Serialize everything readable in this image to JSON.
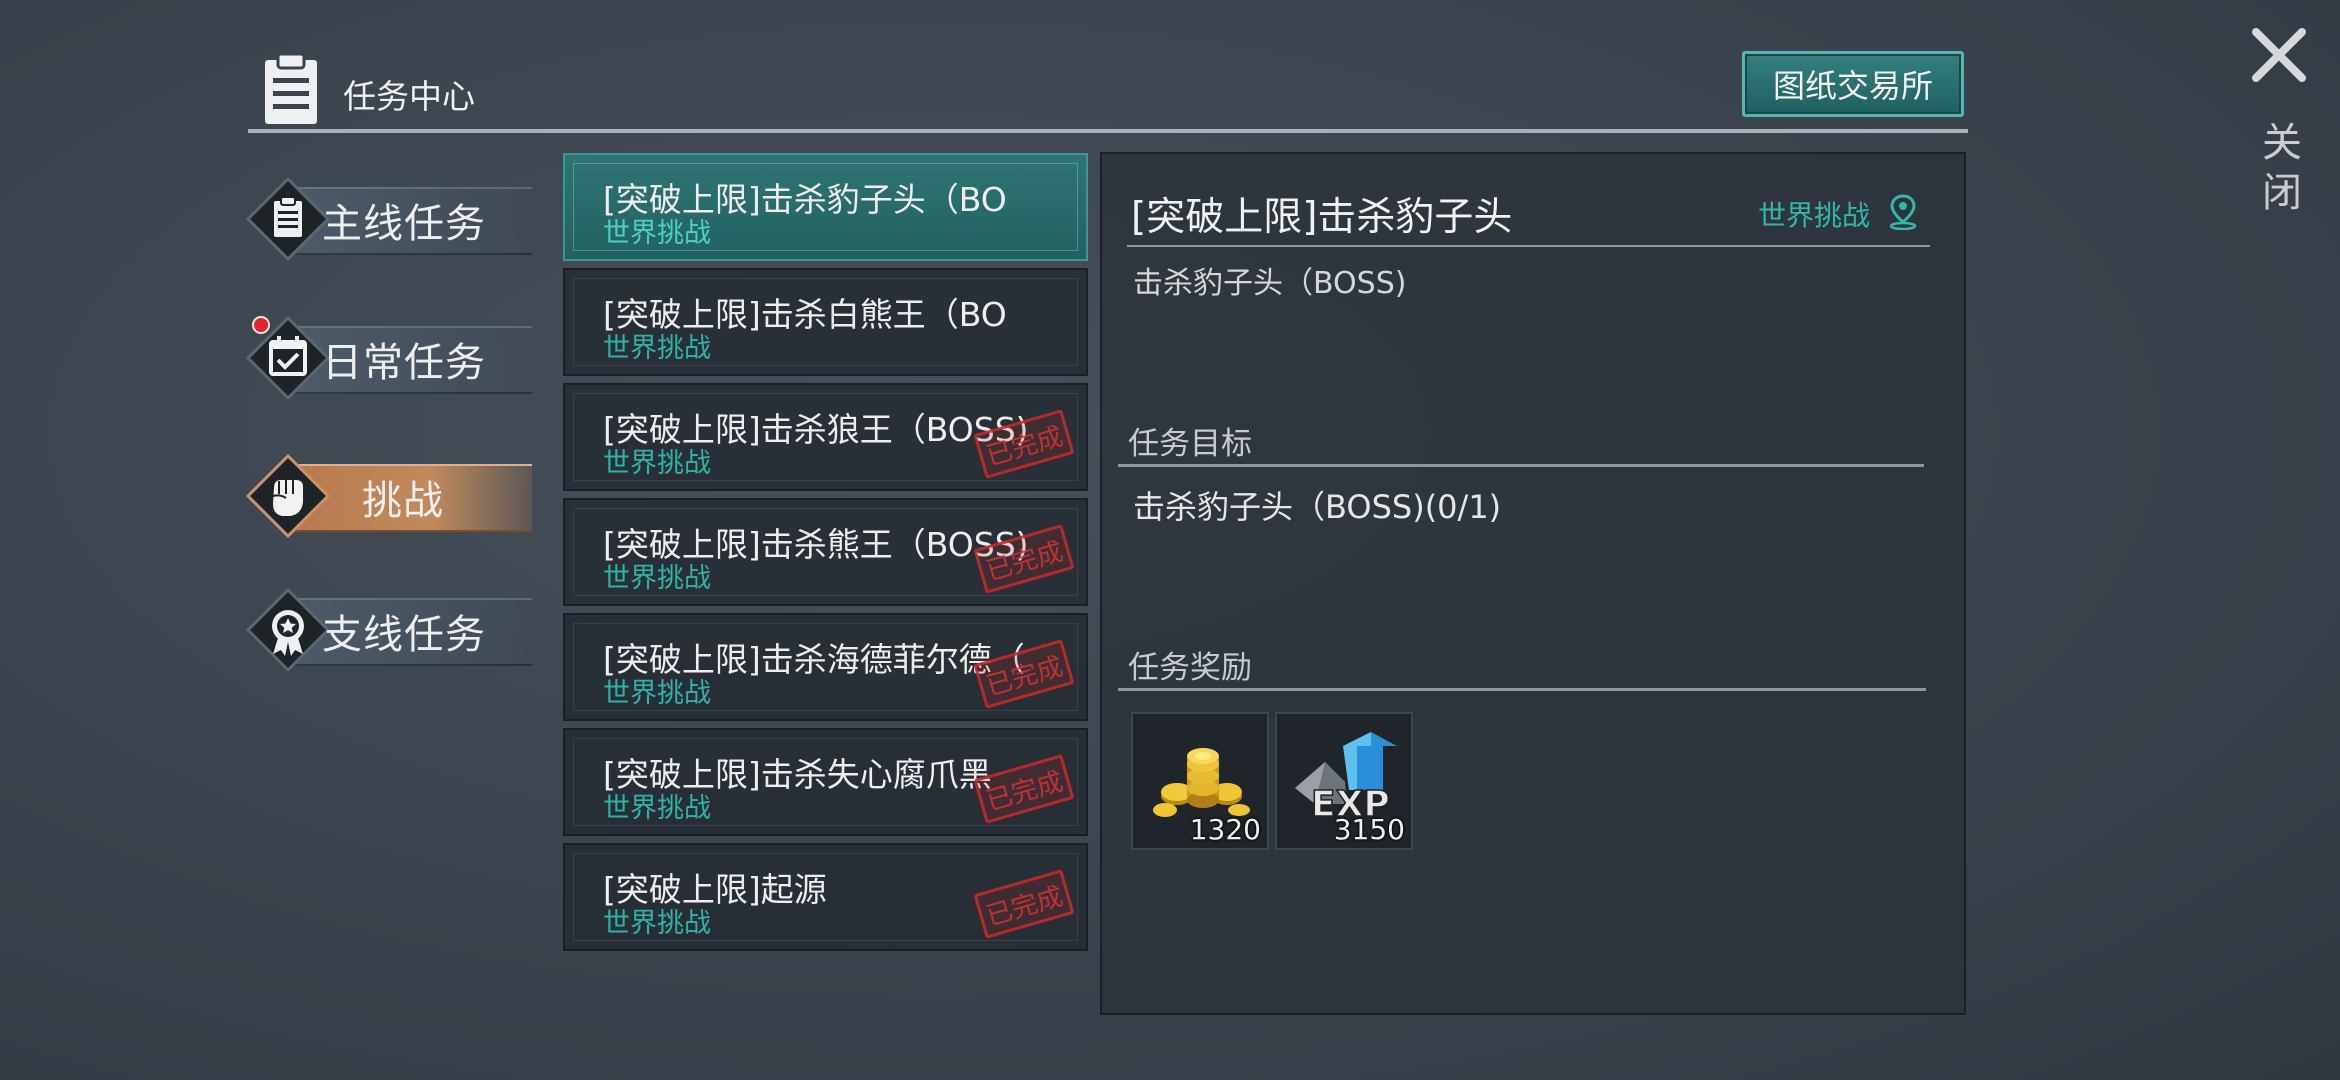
{
  "header": {
    "title": "任务中心",
    "blueprint_button": "图纸交易所"
  },
  "close": {
    "label": "关闭"
  },
  "categories": [
    {
      "label": "主线任务",
      "icon": "clipboard-icon",
      "active": false,
      "notification": false
    },
    {
      "label": "日常任务",
      "icon": "calendar-check-icon",
      "active": false,
      "notification": true
    },
    {
      "label": "挑战",
      "icon": "fist-icon",
      "active": true,
      "notification": false
    },
    {
      "label": "支线任务",
      "icon": "medal-icon",
      "active": false,
      "notification": false
    }
  ],
  "quests": [
    {
      "name": "[突破上限]击杀豹子头（BO",
      "type": "世界挑战",
      "completed": false,
      "selected": true
    },
    {
      "name": "[突破上限]击杀白熊王（BO",
      "type": "世界挑战",
      "completed": false,
      "selected": false
    },
    {
      "name": "[突破上限]击杀狼王（BOSS)",
      "type": "世界挑战",
      "completed": true,
      "selected": false
    },
    {
      "name": "[突破上限]击杀熊王（BOSS)",
      "type": "世界挑战",
      "completed": true,
      "selected": false
    },
    {
      "name": "[突破上限]击杀海德菲尔德（",
      "type": "世界挑战",
      "completed": true,
      "selected": false
    },
    {
      "name": "[突破上限]击杀失心腐爪黑",
      "type": "世界挑战",
      "completed": true,
      "selected": false
    },
    {
      "name": "[突破上限]起源",
      "type": "世界挑战",
      "completed": true,
      "selected": false
    }
  ],
  "completed_stamp": "已完成",
  "detail": {
    "title": "[突破上限]击杀豹子头",
    "tag": "世界挑战",
    "description": "击杀豹子头（BOSS)",
    "objective_heading": "任务目标",
    "objective_text": "击杀豹子头（BOSS)(0/1)",
    "reward_heading": "任务奖励",
    "rewards": [
      {
        "icon": "gold-coins-icon",
        "amount": "1320"
      },
      {
        "icon": "exp-icon",
        "amount": "3150"
      }
    ]
  },
  "colors": {
    "accent_teal": "#2fb3a7",
    "active_tab": "#b7784c",
    "stamp_red": "#d23232"
  }
}
